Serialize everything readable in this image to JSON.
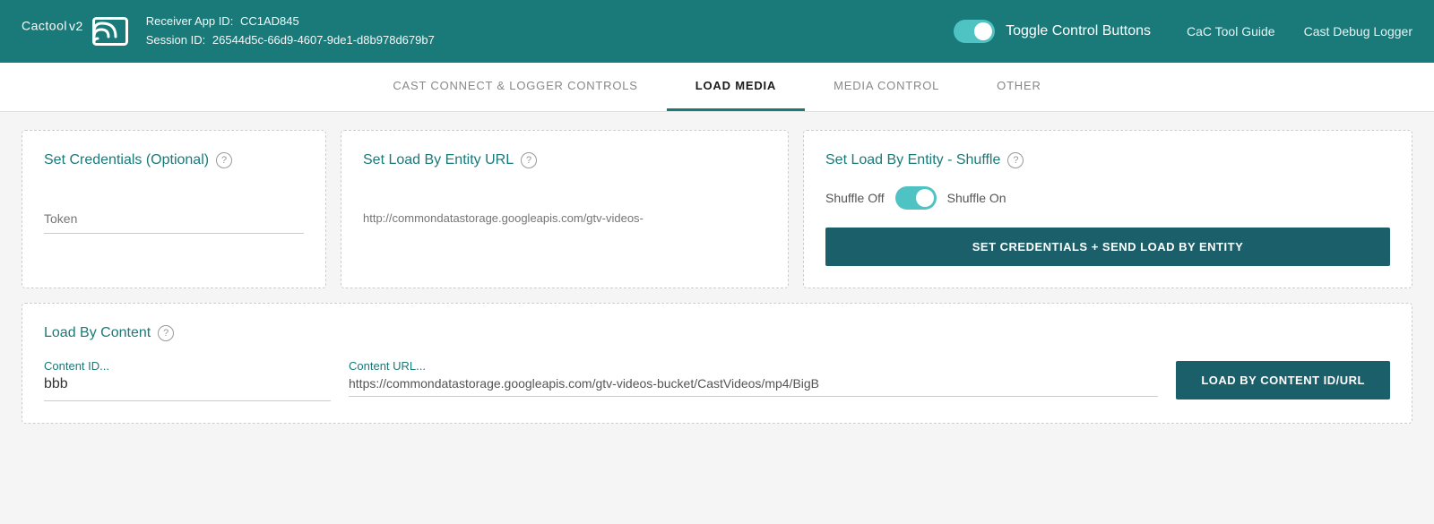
{
  "header": {
    "logo_text": "Cactool",
    "logo_version": "v2",
    "receiver_app_id_label": "Receiver App ID:",
    "receiver_app_id_value": "CC1AD845",
    "session_id_label": "Session ID:",
    "session_id_value": "26544d5c-66d9-4607-9de1-d8b978d679b7",
    "toggle_label": "Toggle Control Buttons",
    "nav_items": [
      {
        "label": "CaC Tool Guide",
        "name": "cac-tool-guide"
      },
      {
        "label": "Cast Debug Logger",
        "name": "cast-debug-logger"
      }
    ]
  },
  "tabs": [
    {
      "label": "CAST CONNECT & LOGGER CONTROLS",
      "name": "tab-cast-connect",
      "active": false
    },
    {
      "label": "LOAD MEDIA",
      "name": "tab-load-media",
      "active": true
    },
    {
      "label": "MEDIA CONTROL",
      "name": "tab-media-control",
      "active": false
    },
    {
      "label": "OTHER",
      "name": "tab-other",
      "active": false
    }
  ],
  "cards": {
    "credentials": {
      "title": "Set Credentials (Optional)",
      "token_placeholder": "Token"
    },
    "entity_url": {
      "title": "Set Load By Entity URL",
      "url_placeholder": "http://commondatastorage.googleapis.com/gtv-videos-"
    },
    "shuffle": {
      "title": "Set Load By Entity - Shuffle",
      "shuffle_off_label": "Shuffle Off",
      "shuffle_on_label": "Shuffle On",
      "button_label": "SET CREDENTIALS + SEND LOAD BY ENTITY"
    },
    "load_content": {
      "title": "Load By Content",
      "content_id_label": "Content ID...",
      "content_id_value": "bbb",
      "content_url_label": "Content URL...",
      "content_url_value": "https://commondatastorage.googleapis.com/gtv-videos-bucket/CastVideos/mp4/BigB",
      "button_label": "LOAD BY CONTENT ID/URL"
    }
  }
}
